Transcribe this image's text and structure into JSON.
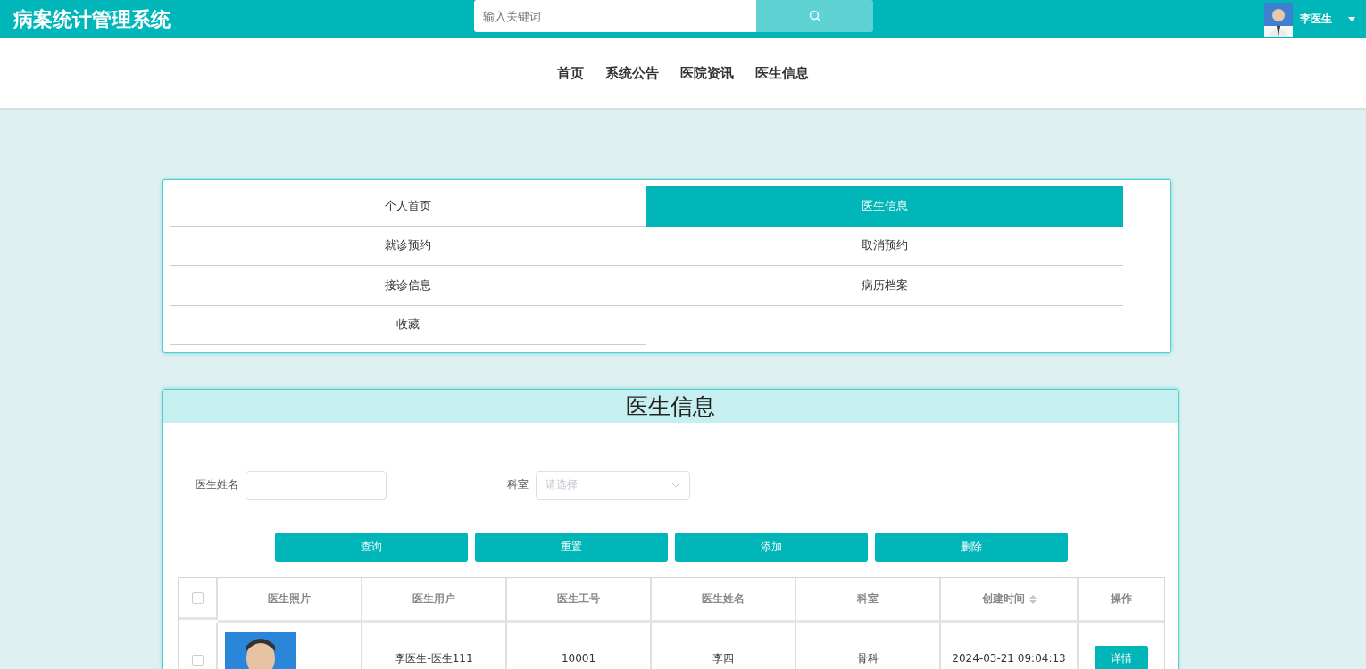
{
  "header": {
    "title": "病案统计管理系统",
    "search": {
      "placeholder": "输入关键词"
    },
    "user": {
      "name": "李医生"
    }
  },
  "nav": [
    {
      "label": "首页"
    },
    {
      "label": "系统公告"
    },
    {
      "label": "医院资讯"
    },
    {
      "label": "医生信息"
    }
  ],
  "menu": [
    {
      "label": "个人首页",
      "selected": false
    },
    {
      "label": "医生信息",
      "selected": true
    },
    {
      "label": "就诊预约",
      "selected": false
    },
    {
      "label": "取消预约",
      "selected": false
    },
    {
      "label": "接诊信息",
      "selected": false
    },
    {
      "label": "病历档案",
      "selected": false
    },
    {
      "label": "收藏",
      "selected": false
    }
  ],
  "panel": {
    "title": "医生信息",
    "filters": [
      {
        "label": "医生姓名",
        "kind": "text"
      },
      {
        "label": "科室",
        "kind": "select",
        "placeholder": "请选择"
      }
    ],
    "buttons": [
      "查询",
      "重置",
      "添加",
      "删除"
    ],
    "table": {
      "select_all": {
        "checked": false
      },
      "columns": [
        {
          "label": "医生照片",
          "sortable": false
        },
        {
          "label": "医生用户",
          "sortable": false
        },
        {
          "label": "医生工号",
          "sortable": false
        },
        {
          "label": "医生姓名",
          "sortable": false
        },
        {
          "label": "科室",
          "sortable": false
        },
        {
          "label": "创建时间",
          "sortable": true
        },
        {
          "label": "操作",
          "sortable": false
        }
      ],
      "rows": [
        {
          "checked": false,
          "cells": [
            {
              "kind": "picture"
            },
            {
              "kind": "text",
              "text": "李医生-医生111"
            },
            {
              "kind": "text",
              "text": "10001"
            },
            {
              "kind": "text",
              "text": "李四"
            },
            {
              "kind": "text",
              "text": "骨科"
            },
            {
              "kind": "text",
              "text": "2024-03-21 09:04:13"
            },
            {
              "kind": "button",
              "text": "详情"
            }
          ]
        }
      ]
    }
  }
}
